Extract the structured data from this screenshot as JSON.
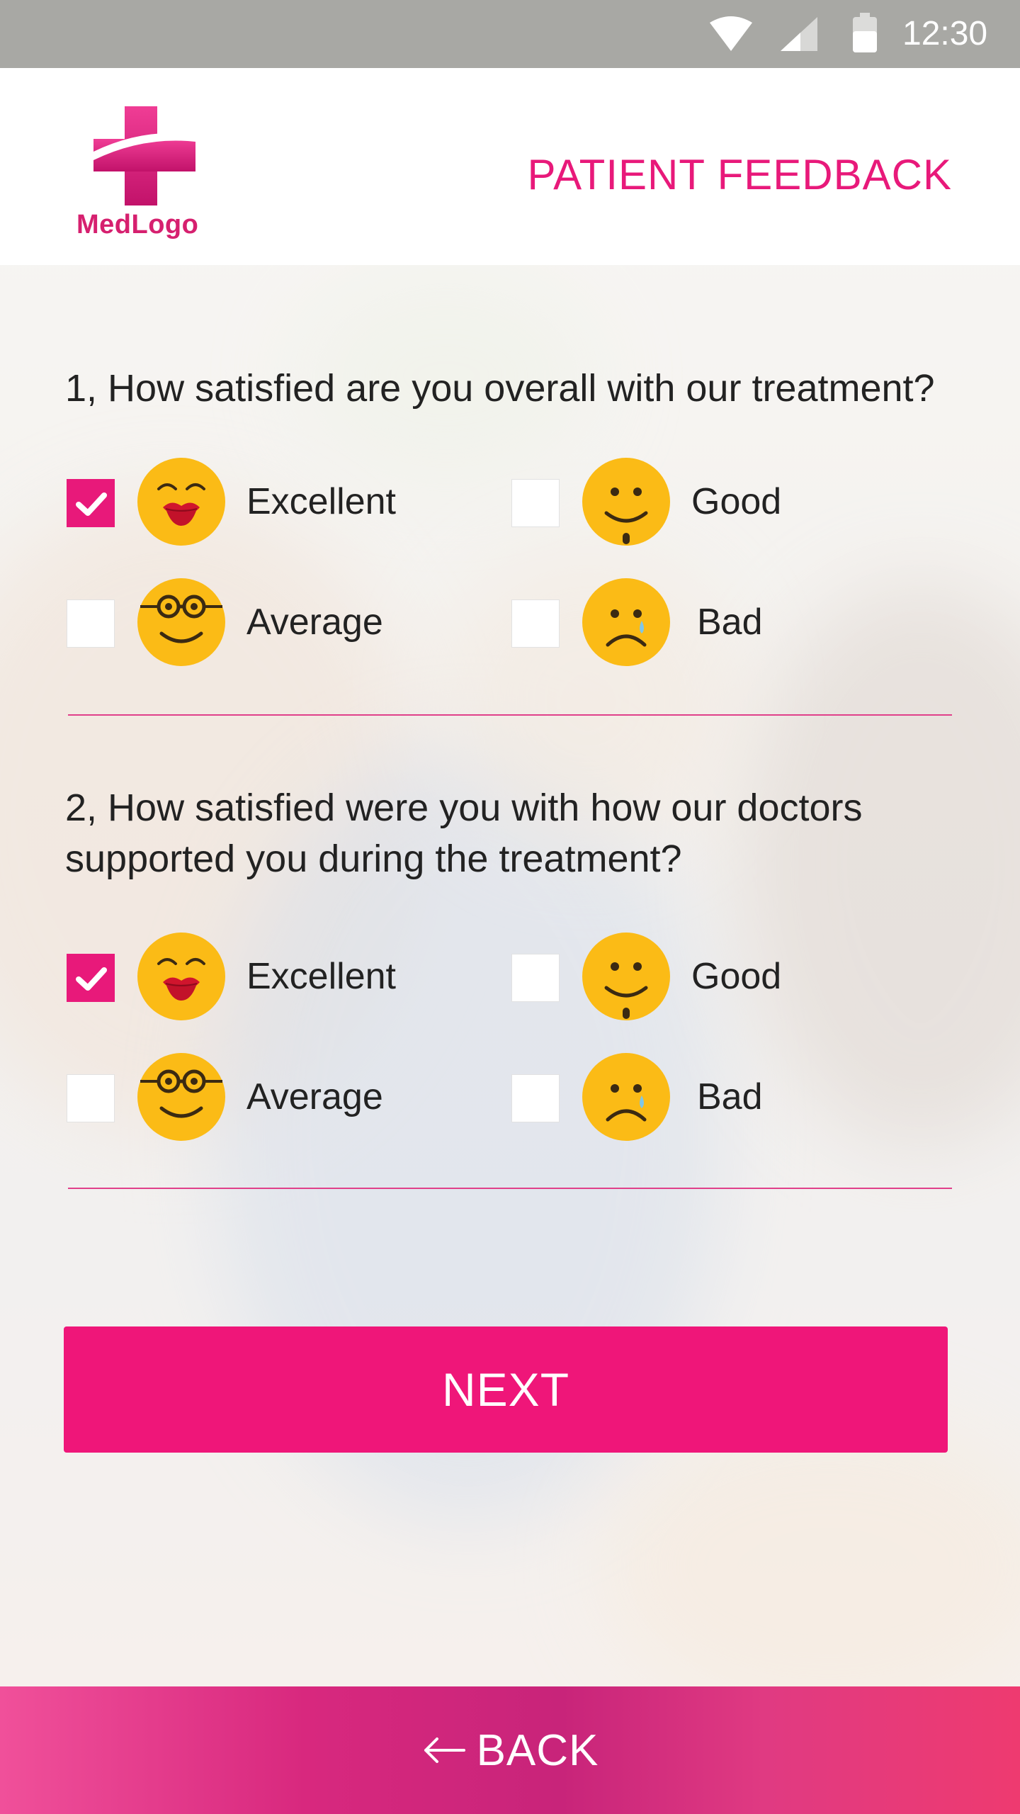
{
  "status_bar": {
    "time": "12:30",
    "icons": [
      "wifi-icon",
      "signal-icon",
      "battery-icon"
    ]
  },
  "header": {
    "logo_text": "MedLogo",
    "title": "PATIENT FEEDBACK"
  },
  "questions": [
    {
      "text": "1, How satisfied are you overall with our treatment?",
      "options": [
        {
          "label": "Excellent",
          "checked": true,
          "icon": "kiss-face-icon"
        },
        {
          "label": "Good",
          "checked": false,
          "icon": "smile-face-icon"
        },
        {
          "label": "Average",
          "checked": false,
          "icon": "glasses-face-icon"
        },
        {
          "label": "Bad",
          "checked": false,
          "icon": "sad-tear-face-icon"
        }
      ]
    },
    {
      "text": "2, How satisfied were you with how our doctors supported you during the treatment?",
      "options": [
        {
          "label": "Excellent",
          "checked": true,
          "icon": "kiss-face-icon"
        },
        {
          "label": "Good",
          "checked": false,
          "icon": "smile-face-icon"
        },
        {
          "label": "Average",
          "checked": false,
          "icon": "glasses-face-icon"
        },
        {
          "label": "Bad",
          "checked": false,
          "icon": "sad-tear-face-icon"
        }
      ]
    }
  ],
  "buttons": {
    "next_label": "NEXT",
    "back_label": "BACK"
  },
  "colors": {
    "accent": "#e8197a",
    "button": "#ef1679",
    "emoji": "#fbbb16",
    "status_bar": "#a8a8a4"
  }
}
